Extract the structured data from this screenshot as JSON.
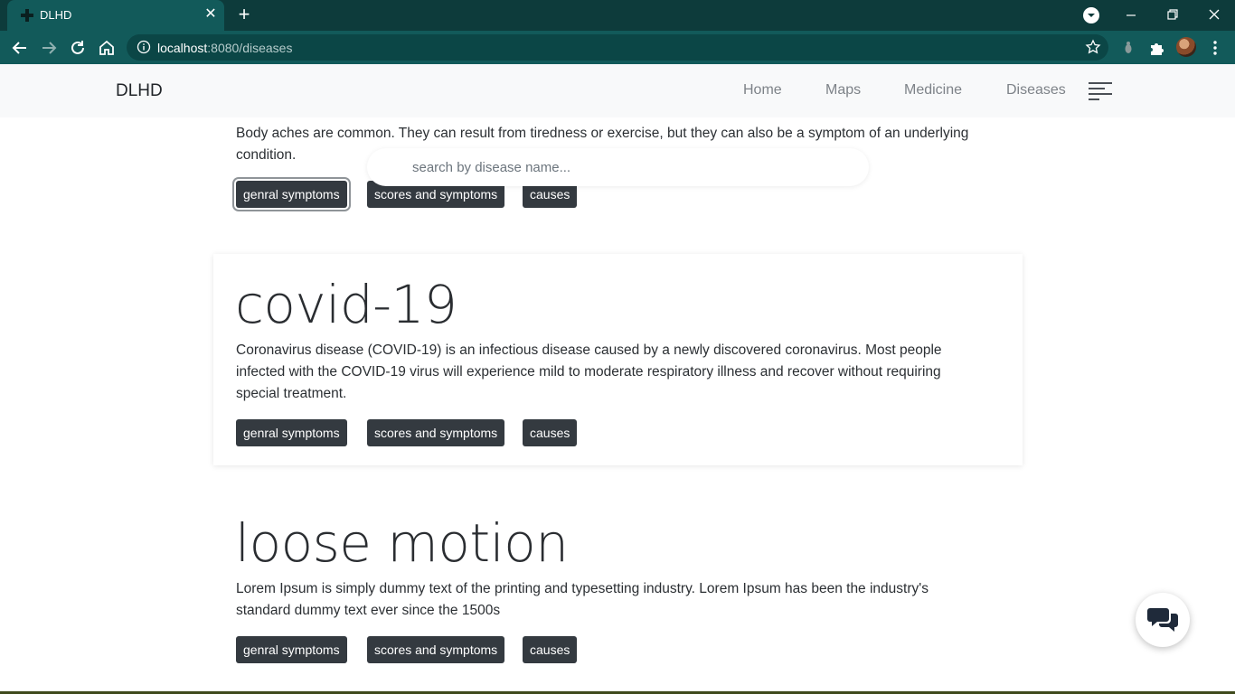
{
  "browser": {
    "tab_title": "DLHD",
    "url_host": "localhost",
    "url_path": ":8080/diseases"
  },
  "navbar": {
    "brand": "DLHD",
    "links": [
      "Home",
      "Maps",
      "Medicine",
      "Diseases"
    ]
  },
  "search": {
    "placeholder": "search by disease name..."
  },
  "diseases": [
    {
      "name": "",
      "description": "Body aches are common. They can result from tiredness or exercise, but they can also be a symptom of an underlying condition.",
      "buttons": [
        "genral symptoms",
        "scores and symptoms",
        "causes"
      ]
    },
    {
      "name": "covid-19",
      "description": "Coronavirus disease (COVID-19) is an infectious disease caused by a newly discovered coronavirus. Most people infected with the COVID-19 virus will experience mild to moderate respiratory illness and recover without requiring special treatment.",
      "buttons": [
        "genral symptoms",
        "scores and symptoms",
        "causes"
      ]
    },
    {
      "name": "loose motion",
      "description": "Lorem Ipsum is simply dummy text of the printing and typesetting industry. Lorem Ipsum has been the industry's standard dummy text ever since the 1500s",
      "buttons": [
        "genral symptoms",
        "scores and symptoms",
        "causes"
      ]
    }
  ],
  "icons": {
    "chat": "chat-bubbles-icon",
    "favicon": "dlhd-favicon-icon"
  },
  "colors": {
    "chrome_dark": "#0d3b3b",
    "chrome_tab": "#125a5a",
    "button_dark": "#343a40",
    "nav_bg": "#f8f9fa"
  }
}
